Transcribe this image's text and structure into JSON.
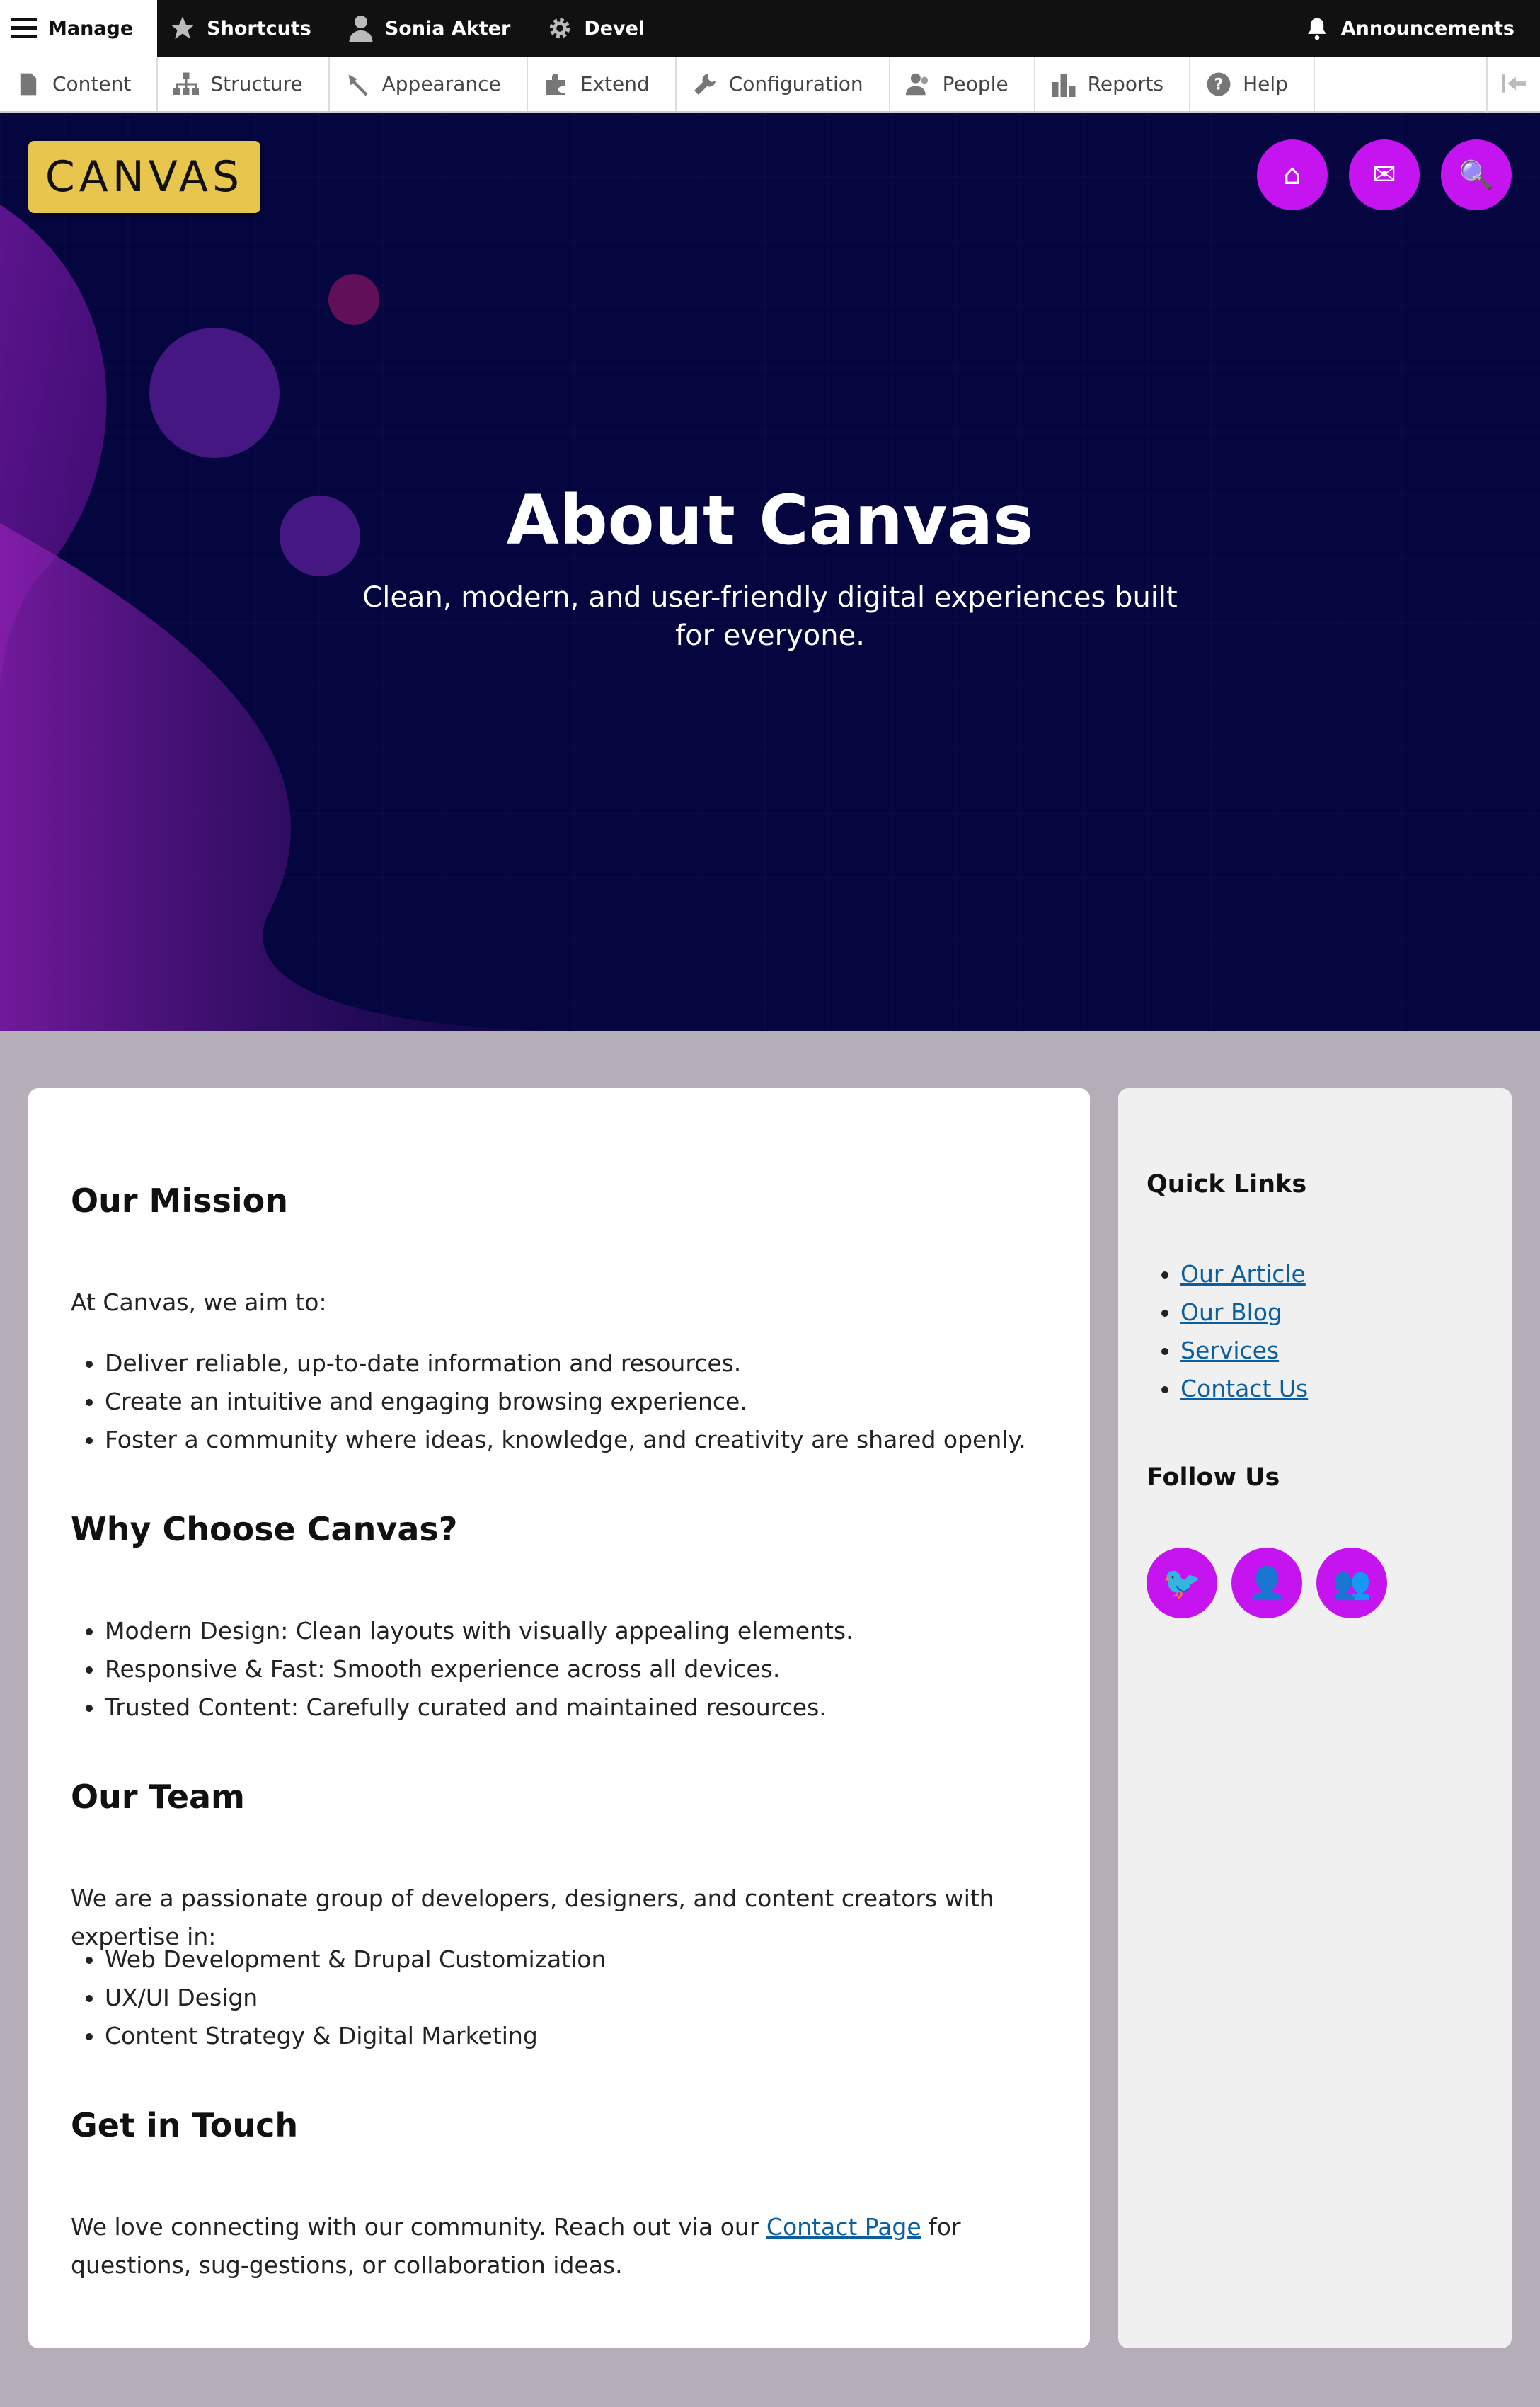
{
  "toolbar": {
    "manage": "Manage",
    "shortcuts": "Shortcuts",
    "user": "Sonia Akter",
    "devel": "Devel",
    "announcements": "Announcements"
  },
  "tray": {
    "items": [
      "Content",
      "Structure",
      "Appearance",
      "Extend",
      "Configuration",
      "People",
      "Reports",
      "Help"
    ]
  },
  "hero": {
    "logo": "CANVAS",
    "title": "About Canvas",
    "subtitle": "Clean, modern, and user-friendly digital experiences built for everyone.",
    "buttons": [
      "⌂",
      "✉",
      "🔍"
    ]
  },
  "main": {
    "mission": {
      "heading": "Our Mission",
      "intro": "At Canvas, we aim to:",
      "items": [
        "Deliver reliable, up-to-date information and resources.",
        "Create an intuitive and engaging browsing experience.",
        "Foster a community where ideas, knowledge, and creativity are shared openly."
      ]
    },
    "why": {
      "heading": "Why Choose Canvas?",
      "items": [
        "Modern Design: Clean layouts with visually appealing elements.",
        "Responsive & Fast: Smooth experience across all devices.",
        "Trusted Content: Carefully curated and maintained resources."
      ]
    },
    "team": {
      "heading": "Our Team",
      "intro": "We are a passionate group of developers, designers, and content creators with expertise in:",
      "items": [
        "Web Development & Drupal Customization",
        "UX/UI Design",
        "Content Strategy & Digital Marketing"
      ]
    },
    "touch": {
      "heading": "Get in Touch",
      "text_before": "We love connecting with our community. Reach out via our ",
      "link": "Contact Page",
      "text_after": " for questions, sug-gestions, or collaboration ideas."
    }
  },
  "sidebar": {
    "quick_links_heading": "Quick Links",
    "links": [
      "Our Article",
      "Our Blog",
      "Services",
      "Contact Us"
    ],
    "follow_heading": "Follow Us",
    "social": [
      "🐦",
      "👤",
      "👥"
    ]
  },
  "colors": {
    "accent": "#c514ef",
    "logo_bg": "#e8c64e",
    "hero_bg": "#050540",
    "link": "#0b5fa0"
  }
}
